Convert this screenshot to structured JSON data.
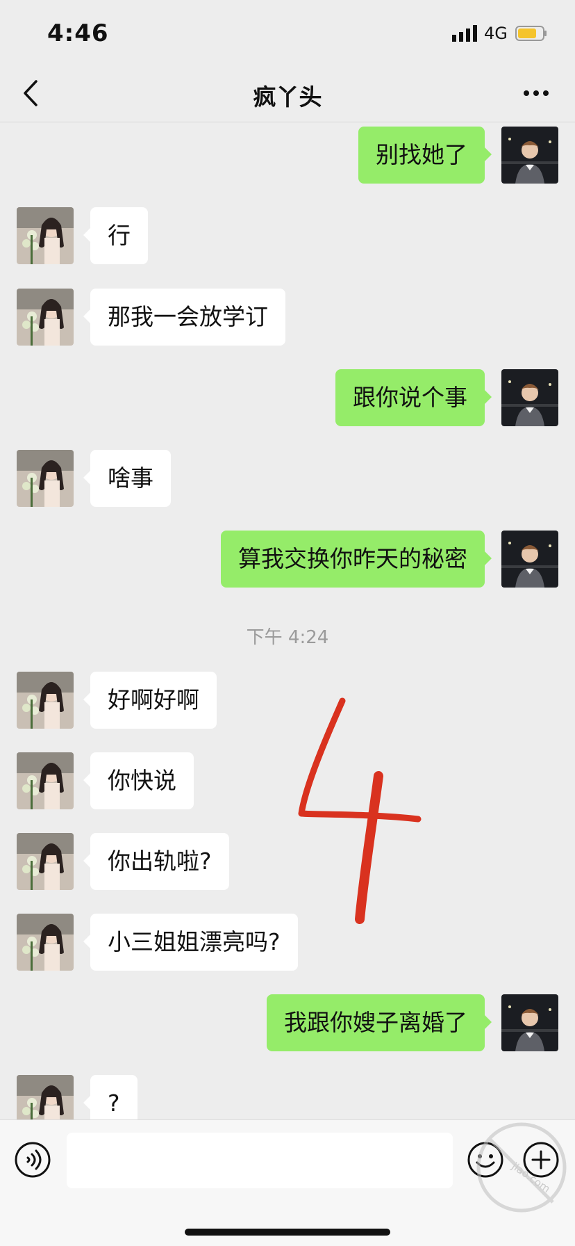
{
  "status_bar": {
    "time": "4:46",
    "network": "4G",
    "battery_color": "#f5c42c"
  },
  "nav": {
    "title": "疯丫头"
  },
  "colors": {
    "outgoing_bubble": "#95ec69",
    "incoming_bubble": "#ffffff",
    "background": "#ededed"
  },
  "messages": [
    {
      "side": "out",
      "text": "别找她了"
    },
    {
      "side": "in",
      "text": "行"
    },
    {
      "side": "in",
      "text": "那我一会放学订"
    },
    {
      "side": "out",
      "text": "跟你说个事"
    },
    {
      "side": "in",
      "text": "啥事"
    },
    {
      "side": "out",
      "text": "算我交换你昨天的秘密"
    },
    {
      "side": "time",
      "text": "下午 4:24"
    },
    {
      "side": "in",
      "text": "好啊好啊"
    },
    {
      "side": "in",
      "text": "你快说"
    },
    {
      "side": "in",
      "text": "你出轨啦?"
    },
    {
      "side": "in",
      "text": "小三姐姐漂亮吗?"
    },
    {
      "side": "out",
      "text": "我跟你嫂子离婚了"
    },
    {
      "side": "in",
      "text": "?"
    }
  ],
  "annotation": {
    "text": "4",
    "color": "#d9321f"
  },
  "input_bar": {
    "value": "",
    "placeholder": ""
  },
  "icons": {
    "back": "back-chevron-icon",
    "more": "more-dots-icon",
    "voice": "voice-icon",
    "emoji": "emoji-icon",
    "add": "plus-icon"
  },
  "watermark_text": "jiao.com"
}
